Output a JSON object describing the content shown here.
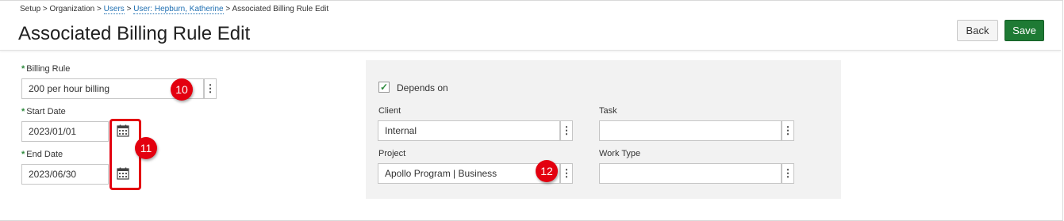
{
  "breadcrumb": {
    "setup": "Setup",
    "sep1": ">",
    "organization": "Organization",
    "sep2": ">",
    "users": "Users",
    "sep3": ">",
    "user": "User: Hepburn, Katherine",
    "sep4": ">",
    "current": "Associated Billing Rule Edit"
  },
  "page_title": "Associated Billing Rule Edit",
  "toolbar": {
    "back_label": "Back",
    "save_label": "Save"
  },
  "form": {
    "billing_rule": {
      "label": "Billing Rule",
      "value": "200 per hour billing"
    },
    "start_date": {
      "label": "Start Date",
      "value": "2023/01/01"
    },
    "end_date": {
      "label": "End Date",
      "value": "2023/06/30"
    },
    "required_marker": "*"
  },
  "depends": {
    "checkbox_label": "Depends on",
    "checked": true,
    "check_glyph": "✓",
    "client": {
      "label": "Client",
      "value": "Internal"
    },
    "task": {
      "label": "Task",
      "value": ""
    },
    "project": {
      "label": "Project",
      "value": "Apollo Program | Business"
    },
    "work_type": {
      "label": "Work Type",
      "value": ""
    }
  },
  "annotations": {
    "badge_10": "10",
    "badge_11": "11",
    "badge_12": "12",
    "badge_color": "#e3000f"
  },
  "icons": {
    "kebab": "⋮",
    "calendar": "calendar-icon"
  },
  "colors": {
    "save_button": "#1e7a34",
    "required": "#2e8b3d",
    "link": "#1f6fb2"
  }
}
